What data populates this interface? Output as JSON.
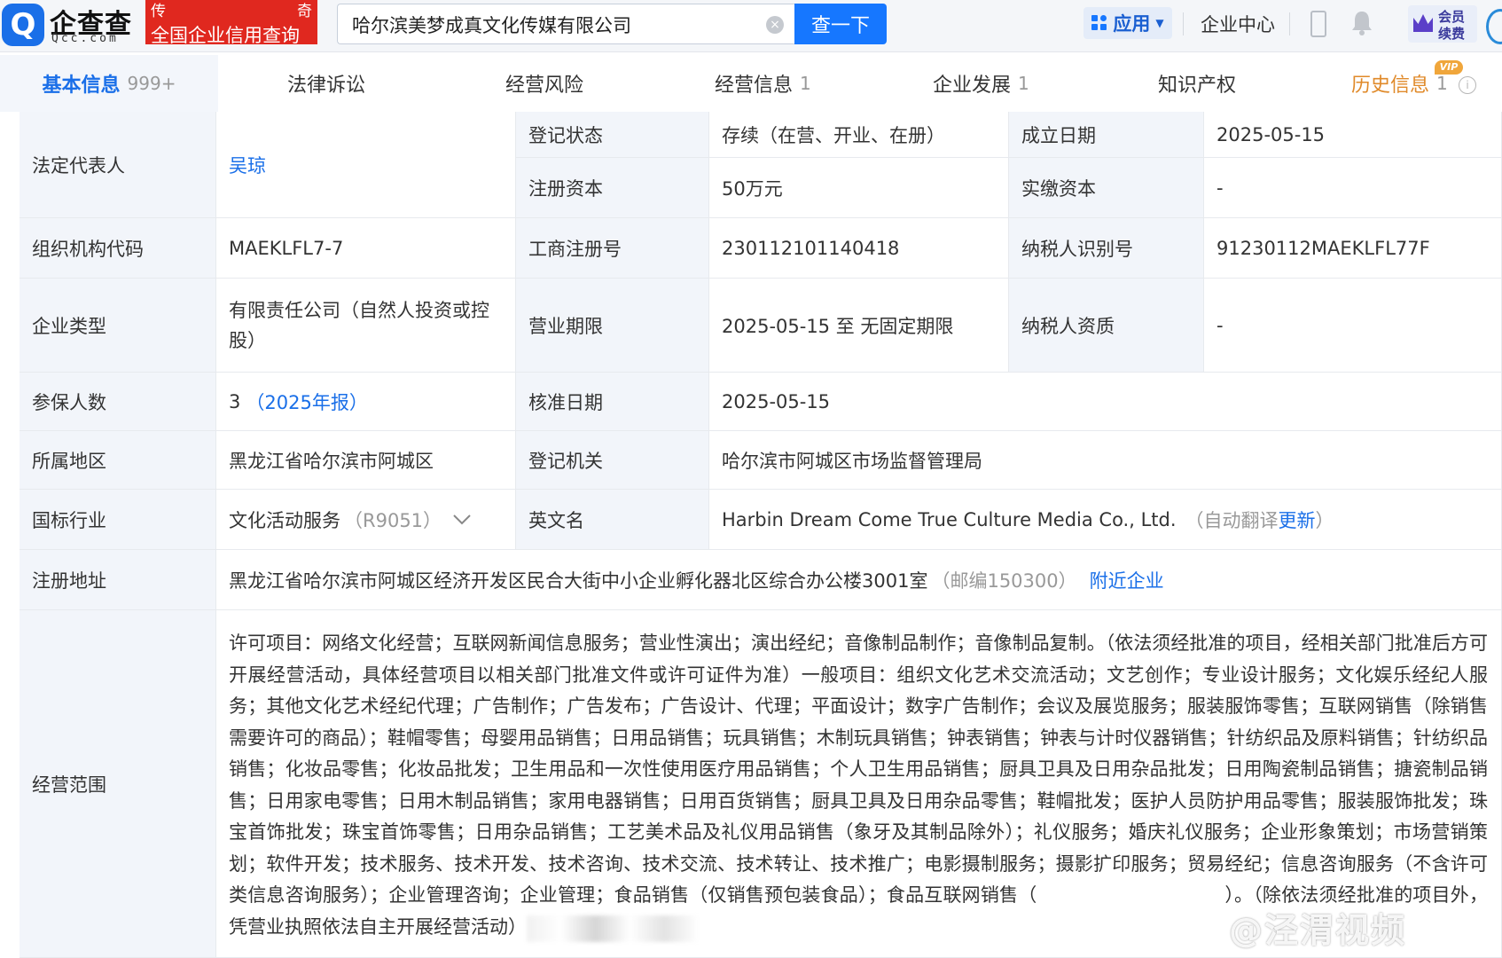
{
  "header": {
    "logo_mark": "Q",
    "logo_name": "企查查",
    "logo_domain": "Qcc.com",
    "banner_left": "传",
    "banner_right": "奇",
    "banner_tagline": "全国企业信用查询",
    "search_value": "哈尔滨美梦成真文化传媒有限公司",
    "search_button": "查一下",
    "apps_label": "应用",
    "enterprise_center": "企业中心",
    "vip_line1": "会员",
    "vip_line2": "续费"
  },
  "tabs": [
    {
      "label": "基本信息",
      "count": "999+"
    },
    {
      "label": "法律诉讼",
      "count": ""
    },
    {
      "label": "经营风险",
      "count": ""
    },
    {
      "label": "经营信息",
      "count": "1"
    },
    {
      "label": "企业发展",
      "count": "1"
    },
    {
      "label": "知识产权",
      "count": ""
    },
    {
      "label": "历史信息",
      "count": "1"
    }
  ],
  "tab_vip_tag": "VIP",
  "info": {
    "legal_rep_label": "法定代表人",
    "legal_rep_value": "吴琼",
    "reg_status_label": "登记状态",
    "reg_status_value": "存续（在营、开业、在册）",
    "founded_label": "成立日期",
    "founded_value": "2025-05-15",
    "reg_capital_label": "注册资本",
    "reg_capital_value": "50万元",
    "paid_capital_label": "实缴资本",
    "paid_capital_value": "-",
    "org_code_label": "组织机构代码",
    "org_code_value": "MAEKLFL7-7",
    "biz_reg_no_label": "工商注册号",
    "biz_reg_no_value": "230112101140418",
    "taxpayer_id_label": "纳税人识别号",
    "taxpayer_id_value": "91230112MAEKLFL77F",
    "company_type_label": "企业类型",
    "company_type_value": "有限责任公司（自然人投资或控股）",
    "biz_term_label": "营业期限",
    "biz_term_value": "2025-05-15 至 无固定期限",
    "taxpayer_qual_label": "纳税人资质",
    "taxpayer_qual_value": "-",
    "insured_label": "参保人数",
    "insured_value": "3",
    "insured_report": "（2025年报）",
    "approval_date_label": "核准日期",
    "approval_date_value": "2025-05-15",
    "region_label": "所属地区",
    "region_value": "黑龙江省哈尔滨市阿城区",
    "authority_label": "登记机关",
    "authority_value": "哈尔滨市阿城区市场监督管理局",
    "industry_label": "国标行业",
    "industry_value": "文化活动服务",
    "industry_code": "（R9051）",
    "english_name_label": "英文名",
    "english_name_value": "Harbin Dream Come True Culture Media Co., Ltd.",
    "auto_translate_prefix": "（自动翻译",
    "auto_translate_link": "更新",
    "auto_translate_suffix": "）",
    "address_label": "注册地址",
    "address_value": "黑龙江省哈尔滨市阿城区经济开发区民合大街中小企业孵化器北区综合办公楼3001室",
    "postcode": "（邮编150300）",
    "nearby_link": "附近企业",
    "scope_label": "经营范围",
    "scope_value": "许可项目：网络文化经营；互联网新闻信息服务；营业性演出；演出经纪；音像制品制作；音像制品复制。（依法须经批准的项目，经相关部门批准后方可开展经营活动，具体经营项目以相关部门批准文件或许可证件为准）一般项目：组织文化艺术交流活动；文艺创作；专业设计服务；文化娱乐经纪人服务；其他文化艺术经纪代理；广告制作；广告发布；广告设计、代理；平面设计；数字广告制作；会议及展览服务；服装服饰零售；互联网销售（除销售需要许可的商品）；鞋帽零售；母婴用品销售；日用品销售；玩具销售；木制玩具销售；钟表销售；钟表与计时仪器销售；针纺织品及原料销售；针纺织品销售；化妆品零售；化妆品批发；卫生用品和一次性使用医疗用品销售；个人卫生用品销售；厨具卫具及日用杂品批发；日用陶瓷制品销售；搪瓷制品销售；日用家电零售；日用木制品销售；家用电器销售；日用百货销售；厨具卫具及日用杂品零售；鞋帽批发；医护人员防护用品零售；服装服饰批发；珠宝首饰批发；珠宝首饰零售；日用杂品销售；工艺美术品及礼仪用品销售（象牙及其制品除外）；礼仪服务；婚庆礼仪服务；企业形象策划；市场营销策划；软件开发；技术服务、技术开发、技术咨询、技术交流、技术转让、技术推广；电影摄制服务；摄影扩印服务；贸易经纪；信息咨询服务（不含许可类信息咨询服务）；企业管理咨询；企业管理；食品销售（仅销售预包装食品）；食品互联网销售（　　　　　　　　　　）。（除依法须经批准的项目外，凭营业执照依法自主开展经营活动）"
  },
  "watermark": "@泾渭视频"
}
